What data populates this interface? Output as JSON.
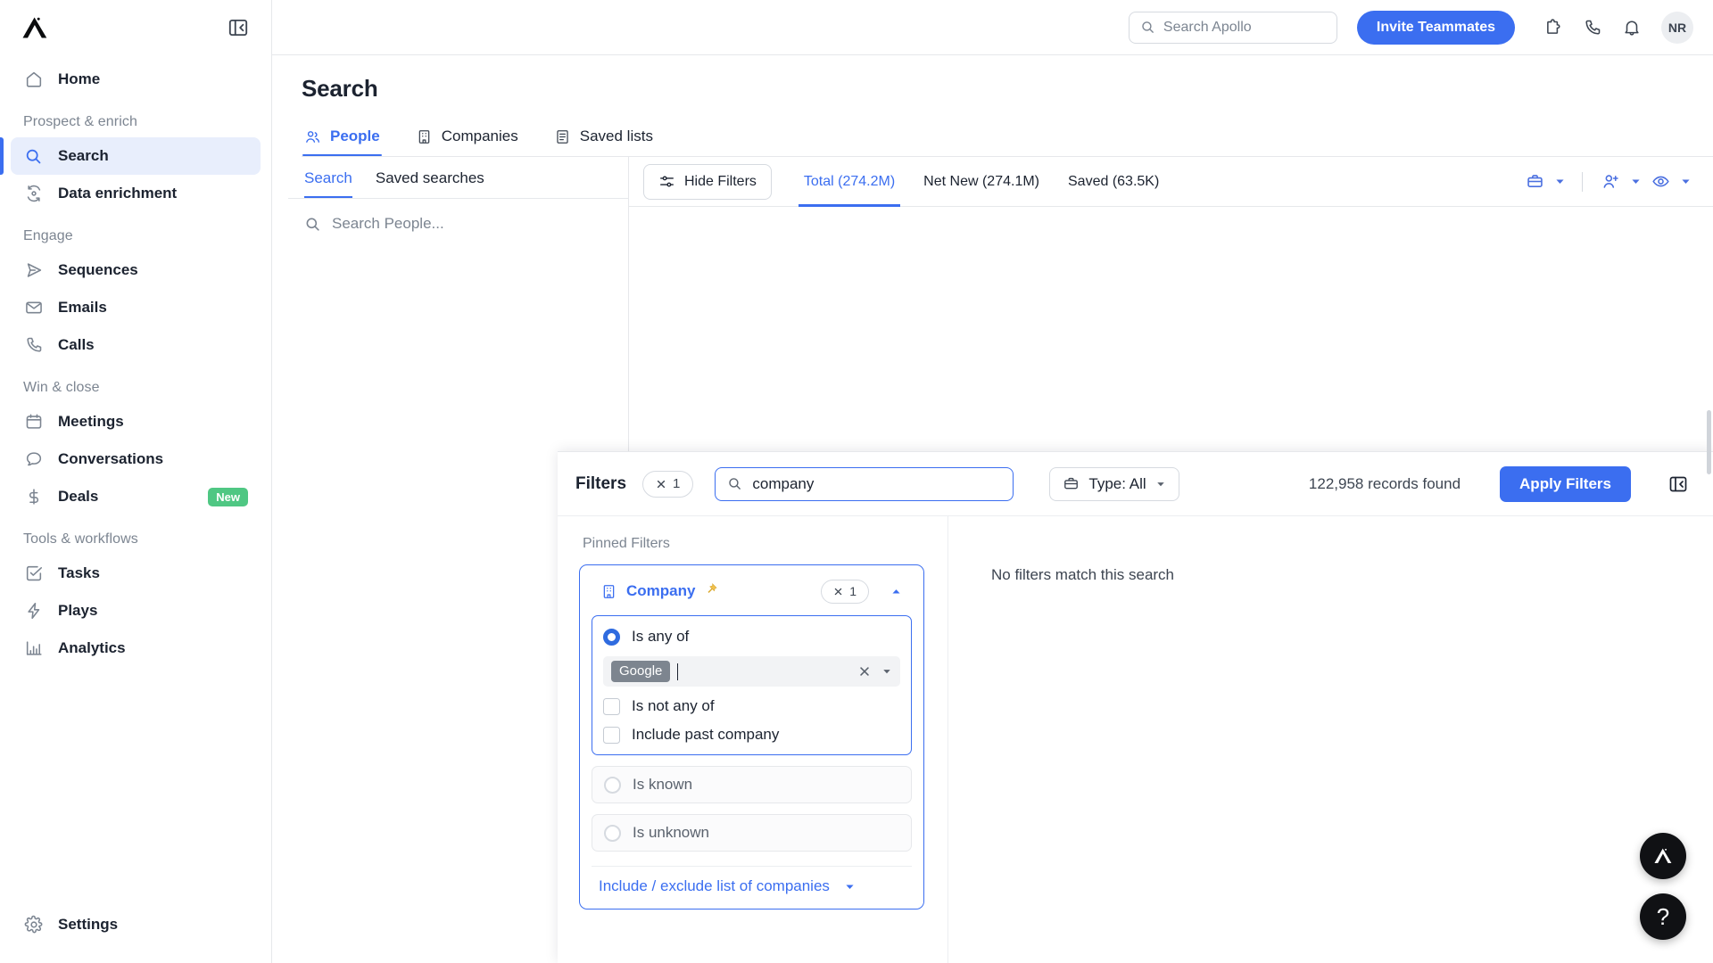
{
  "app": {
    "name": "Apollo",
    "logo_icon": "apollo-logo-icon"
  },
  "sidebar": {
    "collapse_icon": "panel-collapse-icon",
    "groups": [
      {
        "label": "",
        "items": [
          {
            "label": "Home",
            "icon": "home-icon",
            "active": false
          }
        ]
      },
      {
        "label": "Prospect & enrich",
        "items": [
          {
            "label": "Search",
            "icon": "search-icon",
            "active": true
          },
          {
            "label": "Data enrichment",
            "icon": "refresh-data-icon",
            "active": false
          }
        ]
      },
      {
        "label": "Engage",
        "items": [
          {
            "label": "Sequences",
            "icon": "send-icon",
            "active": false
          },
          {
            "label": "Emails",
            "icon": "envelope-icon",
            "active": false
          },
          {
            "label": "Calls",
            "icon": "phone-icon",
            "active": false
          }
        ]
      },
      {
        "label": "Win & close",
        "items": [
          {
            "label": "Meetings",
            "icon": "calendar-icon",
            "active": false
          },
          {
            "label": "Conversations",
            "icon": "chat-bubble-icon",
            "active": false
          },
          {
            "label": "Deals",
            "icon": "dollar-icon",
            "active": false,
            "badge": "New"
          }
        ]
      },
      {
        "label": "Tools & workflows",
        "items": [
          {
            "label": "Tasks",
            "icon": "checkbox-task-icon",
            "active": false
          },
          {
            "label": "Plays",
            "icon": "lightning-icon",
            "active": false
          },
          {
            "label": "Analytics",
            "icon": "bar-chart-icon",
            "active": false
          }
        ]
      }
    ],
    "footer": {
      "label": "Settings",
      "icon": "gear-icon"
    }
  },
  "topbar": {
    "search_placeholder": "Search Apollo",
    "search_icon": "search-icon",
    "invite_label": "Invite Teammates",
    "icons": [
      {
        "name": "puzzle-piece-icon"
      },
      {
        "name": "phone-icon"
      },
      {
        "name": "bell-icon"
      }
    ],
    "avatar_initials": "NR"
  },
  "page": {
    "title": "Search",
    "tabs": [
      {
        "label": "People",
        "icon": "people-icon",
        "active": true
      },
      {
        "label": "Companies",
        "icon": "building-icon",
        "active": false
      },
      {
        "label": "Saved lists",
        "icon": "list-icon",
        "active": false
      }
    ]
  },
  "left_panel": {
    "tabs": [
      {
        "label": "Search",
        "active": true
      },
      {
        "label": "Saved searches",
        "active": false
      }
    ],
    "search_placeholder": "Search People...",
    "search_icon": "search-icon"
  },
  "results_bar": {
    "hide_filters_label": "Hide Filters",
    "hide_filters_icon": "sliders-icon",
    "tabs": [
      {
        "label": "Total (274.2M)",
        "active": true
      },
      {
        "label": "Net New (274.1M)",
        "active": false
      },
      {
        "label": "Saved (63.5K)",
        "active": false
      }
    ],
    "actions": [
      {
        "name": "briefcase-icon",
        "caret": "chevron-down-icon"
      },
      {
        "name": "person-add-icon",
        "caret": "chevron-down-icon"
      },
      {
        "name": "eye-icon",
        "caret": "chevron-down-icon"
      }
    ]
  },
  "filters_panel": {
    "title": "Filters",
    "clear_chip": {
      "icon": "close-icon",
      "count": "1"
    },
    "search_value": "company",
    "search_icon": "search-icon",
    "type_label": "Type: All",
    "type_icon": "briefcase-icon",
    "type_caret": "chevron-down-icon",
    "records_found": "122,958 records found",
    "apply_label": "Apply Filters",
    "collapse_icon": "panel-collapse-icon",
    "pinned_label": "Pinned Filters",
    "empty_state": "No filters match this search",
    "company_filter": {
      "name": "Company",
      "icon": "building-icon",
      "pin_icon": "pin-icon",
      "chip": {
        "icon": "close-icon",
        "count": "1"
      },
      "collapse_caret": "chevron-up-icon",
      "options": [
        {
          "label": "Is any of",
          "type": "radio",
          "selected": true
        },
        {
          "label": "Is known",
          "type": "radio",
          "selected": false
        },
        {
          "label": "Is unknown",
          "type": "radio",
          "selected": false
        }
      ],
      "token_field": {
        "tokens": [
          "Google"
        ],
        "clear_icon": "close-icon",
        "dropdown_icon": "chevron-down-icon"
      },
      "checkboxes": [
        {
          "label": "Is not any of",
          "checked": false
        },
        {
          "label": "Include past company",
          "checked": false
        }
      ],
      "list_link": {
        "label": "Include / exclude list of companies",
        "caret": "chevron-down-icon"
      }
    }
  },
  "fabs": [
    {
      "name": "apollo-assistant-fab",
      "glyph": "logo"
    },
    {
      "name": "help-fab",
      "glyph": "?"
    }
  ],
  "colors": {
    "accent": "#3b6ef0",
    "accent_dark": "#2f6bdf",
    "badge_new": "#4fc783",
    "pin_yellow": "#f2c14e",
    "token_gray": "#7d858f",
    "text": "#1c2330",
    "muted": "#7c8591",
    "border": "#e6e8eb"
  }
}
